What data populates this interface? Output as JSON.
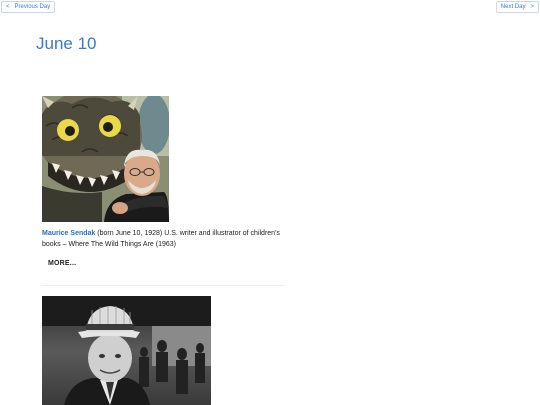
{
  "nav": {
    "prev_label": "Previous Day",
    "next_label": "Next Day",
    "prev_arrow": "<",
    "next_arrow": ">"
  },
  "page": {
    "title": "June 10"
  },
  "entries": [
    {
      "name": "Maurice Sendak",
      "description": " (born June 10, 1928) U.S. writer and illustrator of children's books – Where The Wild Things Are (1963)",
      "more_label": "MORE..."
    }
  ],
  "colors": {
    "accent": "#3a78c9",
    "link": "#1f6fd1"
  }
}
